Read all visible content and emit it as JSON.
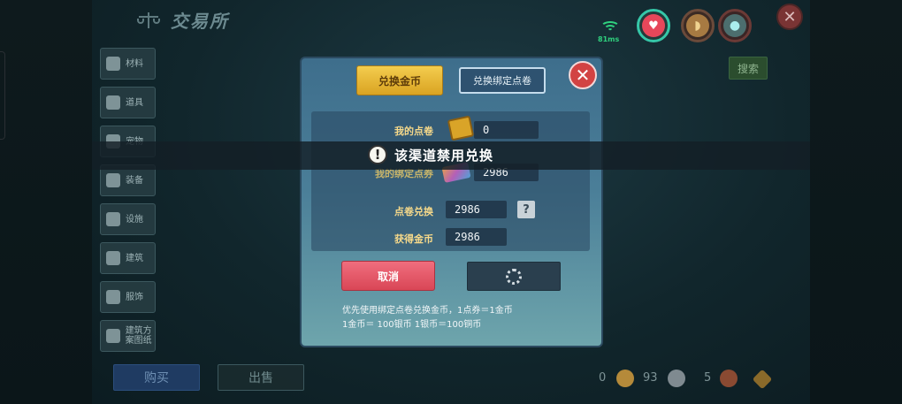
{
  "header": {
    "title": "交易所",
    "ping": "81ms"
  },
  "sidebar": {
    "items": [
      {
        "label": "材料",
        "icon": "material-icon"
      },
      {
        "label": "道具",
        "icon": "item-icon"
      },
      {
        "label": "宠物",
        "icon": "pet-icon"
      },
      {
        "label": "装备",
        "icon": "equipment-icon"
      },
      {
        "label": "设施",
        "icon": "facility-icon"
      },
      {
        "label": "建筑",
        "icon": "building-icon"
      },
      {
        "label": "服饰",
        "icon": "clothing-icon"
      },
      {
        "label": "建筑方案图纸",
        "icon": "blueprint-icon"
      }
    ]
  },
  "search": {
    "label": "搜索"
  },
  "bottom": {
    "buy": "购买",
    "sell": "出售",
    "gold": "0",
    "silver": "93",
    "copper": "5"
  },
  "modal": {
    "tab_gold": "兑换金币",
    "tab_bind": "兑换绑定点卷",
    "my_points_label": "我的点卷",
    "my_points_value": "0",
    "bound_points_label": "我的绑定点券",
    "bound_points_value": "2986",
    "exchange_label": "点卷兑换",
    "exchange_value": "2986",
    "obtain_label": "获得金币",
    "obtain_value": "2986",
    "help": "?",
    "cancel": "取消",
    "note_line1": "优先使用绑定点卷兑换金币，1点券＝1金币",
    "note_line2": "1金币＝ 100银币   1银币＝100铜币"
  },
  "toast": {
    "icon": "!",
    "text": "该渠道禁用兑换"
  },
  "colors": {
    "gold_tab": "#e6b63a",
    "cancel": "#e35a6a",
    "toast_bg": "#141e26"
  }
}
